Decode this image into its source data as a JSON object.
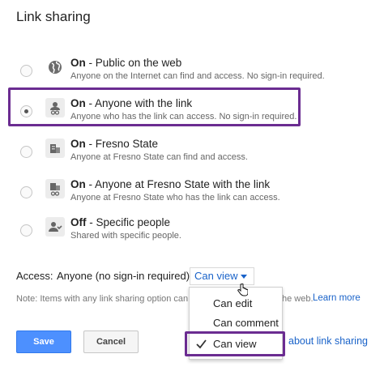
{
  "title": "Link sharing",
  "options": [
    {
      "status": "On",
      "label": " - Public on the web",
      "desc": "Anyone on the Internet can find and access. No sign-in required.",
      "icon": "globe-icon",
      "checked": false
    },
    {
      "status": "On",
      "label": " - Anyone with the link",
      "desc": "Anyone who has the link can access. No sign-in required.",
      "icon": "link-person-icon",
      "checked": true
    },
    {
      "status": "On",
      "label": " - Fresno State",
      "desc": "Anyone at Fresno State can find and access.",
      "icon": "building-icon",
      "checked": false
    },
    {
      "status": "On",
      "label": " - Anyone at Fresno State with the link",
      "desc": "Anyone at Fresno State who has the link can access.",
      "icon": "building-link-icon",
      "checked": false
    },
    {
      "status": "Off",
      "label": " - Specific people",
      "desc": "Shared with specific people.",
      "icon": "people-icon",
      "checked": false
    }
  ],
  "access": {
    "label": "Access:",
    "value": "Anyone (no sign-in required)",
    "selected": "Can view"
  },
  "note": {
    "text": "Note: Items with any link sharing option can",
    "tail": "he web.",
    "learn_more": "Learn more"
  },
  "buttons": {
    "save": "Save",
    "cancel": "Cancel"
  },
  "about_link": "about link sharing",
  "dropdown": {
    "items": [
      "Can edit",
      "Can comment",
      "Can view"
    ],
    "checked_index": 2
  },
  "colors": {
    "accent": "#6b2c91",
    "link": "#1a63c9",
    "primary_button": "#4d90fe"
  }
}
